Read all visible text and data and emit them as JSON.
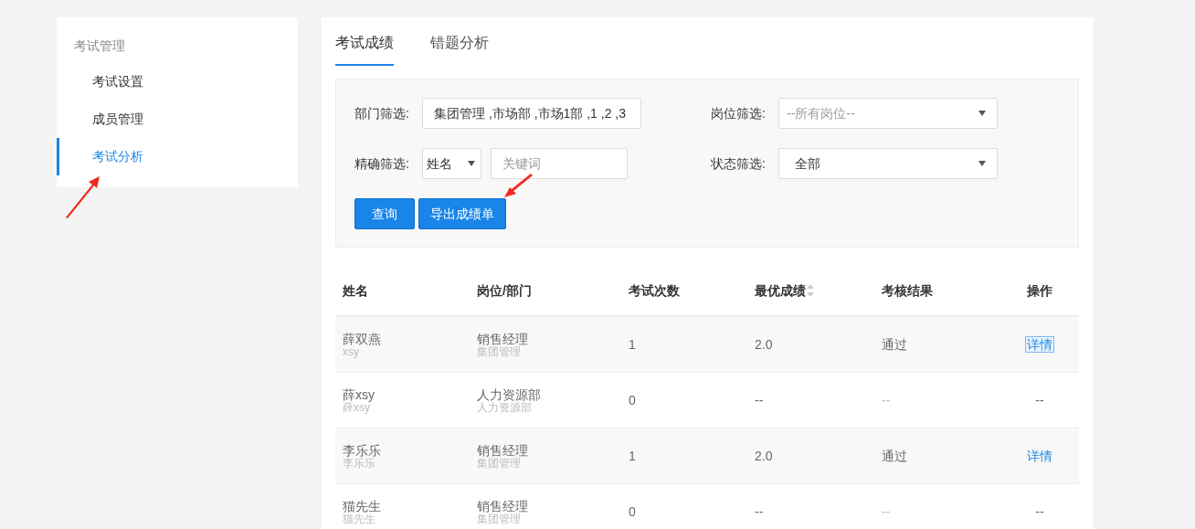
{
  "sidebar": {
    "title": "考试管理",
    "items": [
      {
        "label": "考试设置",
        "selected": false
      },
      {
        "label": "成员管理",
        "selected": false
      },
      {
        "label": "考试分析",
        "selected": true
      }
    ]
  },
  "tabs": [
    {
      "label": "考试成绩",
      "selected": true
    },
    {
      "label": "错题分析",
      "selected": false
    }
  ],
  "filters": {
    "department": {
      "label": "部门筛选:",
      "value": "集团管理 ,市场部 ,市场1部 ,1 ,2 ,3"
    },
    "position": {
      "label": "岗位筛选:",
      "placeholder": "--所有岗位--"
    },
    "exact": {
      "label": "精确筛选:",
      "field": "姓名",
      "placeholder": "关键词"
    },
    "status": {
      "label": "状态筛选:",
      "value": "全部"
    }
  },
  "buttons": [
    "查询",
    "导出成绩单"
  ],
  "table": {
    "columns": [
      "姓名",
      "岗位/部门",
      "考试次数",
      "最优成绩",
      "考核结果",
      "操作"
    ],
    "rows": [
      {
        "name": "薛双燕",
        "account": "xsy",
        "position": "销售经理",
        "department": "集团管理",
        "count": "1",
        "score": "2.0",
        "result": "通过",
        "action": {
          "kind": "link",
          "label": "详情",
          "focused": true
        }
      },
      {
        "name": "薛xsy",
        "account": "薛xsy",
        "position": "人力资源部",
        "department": "人力资源部",
        "count": "0",
        "score": "--",
        "result": "--",
        "result_muted": true,
        "action": {
          "kind": "text",
          "label": "--"
        }
      },
      {
        "name": "李乐乐",
        "account": "李乐乐",
        "position": "销售经理",
        "department": "集团管理",
        "count": "1",
        "score": "2.0",
        "result": "通过",
        "action": {
          "kind": "link",
          "label": "详情",
          "focused": false
        }
      },
      {
        "name": "猫先生",
        "account": "猫先生",
        "position": "销售经理",
        "department": "集团管理",
        "count": "0",
        "score": "--",
        "result": "--",
        "result_muted": true,
        "action": {
          "kind": "text",
          "label": "--"
        }
      }
    ]
  }
}
